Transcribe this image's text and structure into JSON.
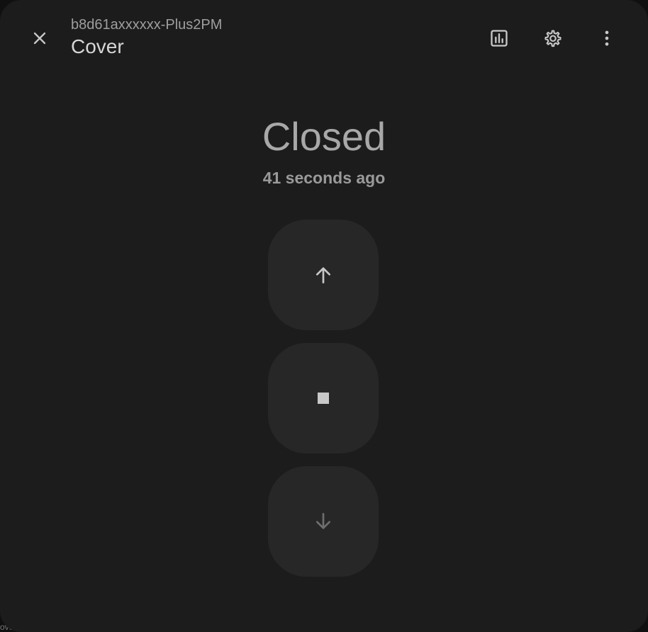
{
  "background_text": "ove",
  "header": {
    "subtitle": "b8d61axxxxxx-Plus2PM",
    "title": "Cover"
  },
  "state": {
    "label": "Closed",
    "last_changed": "41 seconds ago"
  },
  "controls": [
    "open",
    "stop",
    "close"
  ],
  "icons": {
    "close": "close-icon",
    "history": "chart-box-icon",
    "settings": "gear-icon",
    "menu": "dots-vertical-icon",
    "open": "arrow-up-icon",
    "stop": "stop-icon",
    "close_cover": "arrow-down-icon"
  },
  "colors": {
    "dialog_bg": "#1c1c1c",
    "control_bg": "#272727",
    "icon": "#c8c8c8",
    "disabled_icon": "#6f6f6f"
  }
}
